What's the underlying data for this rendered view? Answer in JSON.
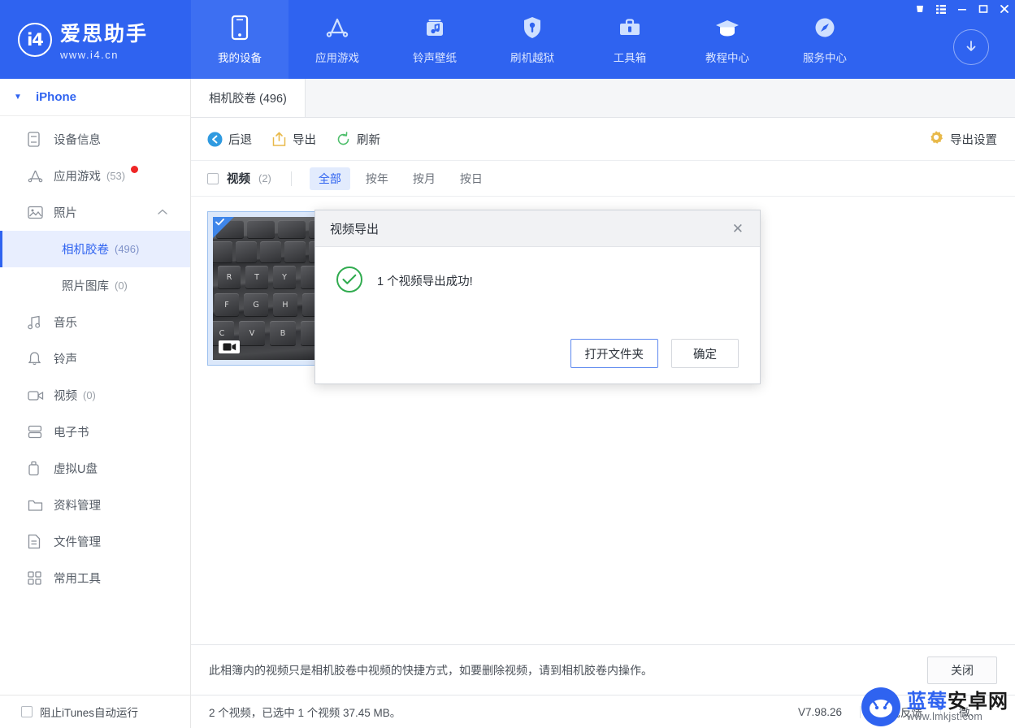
{
  "brand": {
    "name": "爱思助手",
    "url": "www.i4.cn",
    "logo_text": "i4"
  },
  "topnav": {
    "items": [
      {
        "label": "我的设备",
        "icon": "phone-icon",
        "active": true
      },
      {
        "label": "应用游戏",
        "icon": "appstore-icon",
        "active": false
      },
      {
        "label": "铃声壁纸",
        "icon": "music-box-icon",
        "active": false
      },
      {
        "label": "刷机越狱",
        "icon": "shield-key-icon",
        "active": false
      },
      {
        "label": "工具箱",
        "icon": "toolbox-icon",
        "active": false
      },
      {
        "label": "教程中心",
        "icon": "graduation-cap-icon",
        "active": false
      },
      {
        "label": "服务中心",
        "icon": "compass-icon",
        "active": false
      }
    ],
    "download_icon": "download-circle-icon",
    "window_controls": [
      "message-icon",
      "list-icon",
      "minimize-icon",
      "maximize-icon",
      "close-icon"
    ]
  },
  "sidebar": {
    "device": {
      "name": "iPhone",
      "caret": "▼"
    },
    "items": [
      {
        "label": "设备信息",
        "icon": "device-info-icon",
        "count": "",
        "badge": false
      },
      {
        "label": "应用游戏",
        "icon": "appstore-icon",
        "count": "(53)",
        "badge": true
      },
      {
        "label": "照片",
        "icon": "photo-icon",
        "count": "",
        "badge": false,
        "expanded": true,
        "children": [
          {
            "label": "相机胶卷",
            "count": "(496)",
            "active": true
          },
          {
            "label": "照片图库",
            "count": "(0)",
            "active": false
          }
        ]
      },
      {
        "label": "音乐",
        "icon": "music-note-icon",
        "count": "",
        "badge": false
      },
      {
        "label": "铃声",
        "icon": "bell-icon",
        "count": "",
        "badge": false
      },
      {
        "label": "视频",
        "icon": "video-icon",
        "count": "(0)",
        "badge": false
      },
      {
        "label": "电子书",
        "icon": "book-icon",
        "count": "",
        "badge": false
      },
      {
        "label": "虚拟U盘",
        "icon": "usb-icon",
        "count": "",
        "badge": false
      },
      {
        "label": "资料管理",
        "icon": "folder-icon",
        "count": "",
        "badge": false
      },
      {
        "label": "文件管理",
        "icon": "file-icon",
        "count": "",
        "badge": false
      },
      {
        "label": "常用工具",
        "icon": "grid-tools-icon",
        "count": "",
        "badge": false
      }
    ],
    "footer_checkbox": {
      "label": "阻止iTunes自动运行",
      "checked": false
    }
  },
  "main": {
    "tab": {
      "label": "相机胶卷 (496)"
    },
    "toolbar": {
      "back": {
        "label": "后退",
        "icon": "back-arrow-icon"
      },
      "export": {
        "label": "导出",
        "icon": "export-icon"
      },
      "refresh": {
        "label": "刷新",
        "icon": "refresh-icon"
      },
      "settings": {
        "label": "导出设置",
        "icon": "gear-icon"
      }
    },
    "filterbar": {
      "select_all": {
        "label": "视频",
        "count": "(2)",
        "checked": false
      },
      "segments": [
        {
          "label": "全部",
          "active": true
        },
        {
          "label": "按年",
          "active": false
        },
        {
          "label": "按月",
          "active": false
        },
        {
          "label": "按日",
          "active": false
        }
      ]
    },
    "thumbnail": {
      "selected": true,
      "type_badge": "video-camera-icon",
      "keys": [
        "R",
        "T",
        "Y",
        "F",
        "G",
        "H",
        "C",
        "V",
        "B"
      ]
    },
    "notebar": {
      "text": "此相簿内的视频只是相机胶卷中视频的快捷方式，如要删除视频，请到相机胶卷内操作。",
      "close_label": "关闭"
    },
    "statusbar": {
      "info": "2 个视频，已选中 1 个视频 37.45 MB。",
      "version": "V7.98.26",
      "feedback": "意见反馈",
      "weixin": "微、"
    }
  },
  "modal": {
    "title": "视频导出",
    "close_icon": "close-icon",
    "status_icon": "success-check-icon",
    "message": "1 个视频导出成功!",
    "primary_button": "打开文件夹",
    "secondary_button": "确定"
  },
  "watermark": {
    "title_blue": "蓝莓",
    "title_dark": "安卓网",
    "url": "www.lmkjst.com"
  },
  "colors": {
    "brand_blue": "#2f63f0",
    "accent_blue": "#3d6ff2",
    "badge_red": "#ef2626",
    "success_green": "#30ab4f",
    "select_bg": "#e8eefe"
  }
}
